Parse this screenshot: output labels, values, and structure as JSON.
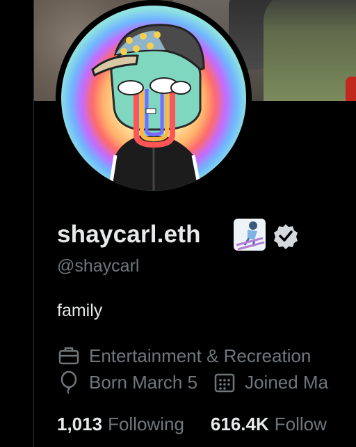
{
  "profile": {
    "display_name": "shaycarl.eth",
    "handle": "@shaycarl",
    "bio": "family",
    "category": "Entertainment & Recreation",
    "birthday": "Born March 5",
    "joined": "Joined Ma",
    "following_count": "1,013",
    "following_label": "Following",
    "followers_count": "616.4K",
    "followers_label": "Follow"
  },
  "icons": {
    "name_emoji": "skier-emoji",
    "verified": "verified-badge-icon",
    "category": "briefcase-icon",
    "birthday": "balloon-icon",
    "joined": "calendar-icon"
  },
  "colors": {
    "background": "#000000",
    "primary_text": "#e7e9ea",
    "secondary_text": "#71767b"
  }
}
